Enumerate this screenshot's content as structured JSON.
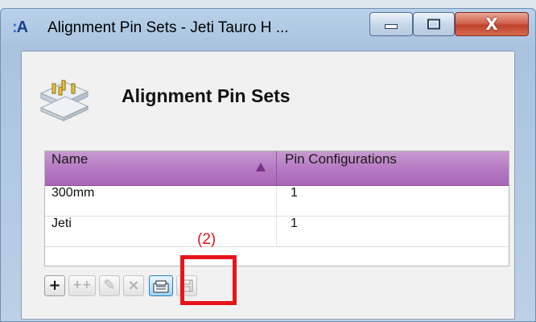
{
  "window": {
    "app_icon": "A",
    "title": "Alignment Pin Sets - Jeti Tauro H ...",
    "controls": {
      "minimize_icon": "minimize-icon",
      "maximize_icon": "maximize-icon",
      "close_glyph": "X"
    }
  },
  "header": {
    "title": "Alignment Pin Sets",
    "icon": "pin-sets-icon"
  },
  "table": {
    "columns": [
      "Name",
      "Pin Configurations"
    ],
    "sort": {
      "column": "Name",
      "direction": "ascending"
    },
    "rows": [
      {
        "name": "300mm",
        "pins": "1"
      },
      {
        "name": "Jeti",
        "pins": "1"
      }
    ]
  },
  "toolbar": {
    "add": "+",
    "add_multiple": "++",
    "edit": "✎",
    "delete": "×",
    "save": "save-icon"
  },
  "annotation": {
    "label": "(2)",
    "color": "#e8141b"
  },
  "colors": {
    "header_purple": "#b578c2",
    "accent_blue": "#2c7fb8"
  }
}
